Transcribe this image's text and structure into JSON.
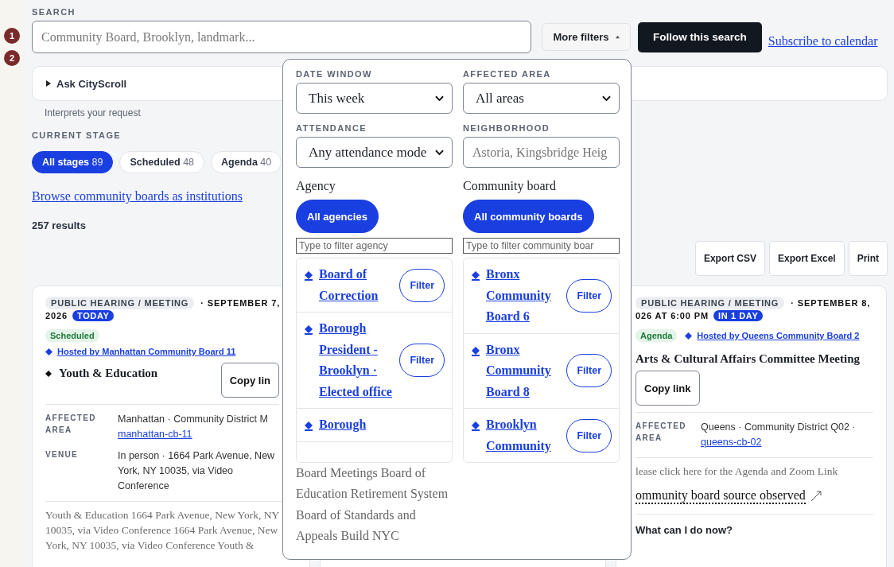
{
  "annotations": [
    "1",
    "2"
  ],
  "search": {
    "label": "SEARCH",
    "placeholder": "Community Board, Brooklyn, landmark..."
  },
  "more_filters": {
    "label": "More filters",
    "expanded": true
  },
  "follow_button": "Follow this search",
  "subscribe_link": "Subscribe to calendar",
  "ask": {
    "label": "Ask CityScroll",
    "expanded": false,
    "hint": "Interprets your request"
  },
  "stage": {
    "label": "CURRENT STAGE",
    "chips": [
      {
        "label": "All stages",
        "count": "89",
        "selected": true
      },
      {
        "label": "Scheduled",
        "count": "48",
        "selected": false
      },
      {
        "label": "Agenda",
        "count": "40",
        "selected": false
      }
    ]
  },
  "browse_link": "Browse community boards as institutions",
  "results": "257 results",
  "export_buttons": [
    "Export CSV",
    "Export Excel",
    "Print"
  ],
  "cards": [
    {
      "type": "PUBLIC HEARING / MEETING",
      "date": "· SEPTEMBER 7,",
      "date_continued": "2026",
      "relative": "TODAY",
      "stage": "Scheduled",
      "host": "Hosted by Manhattan Community Board 11",
      "bullet": true,
      "title": "Youth & Education",
      "copy_button": "Copy lin",
      "details": [
        {
          "label": "AFFECTED AREA",
          "value": "Manhattan · Community District M",
          "link": "manhattan-cb-11"
        },
        {
          "label": "VENUE",
          "value": "In person · 1664 Park Avenue, New York, NY 10035, via Video Conference"
        }
      ],
      "description": "Youth & Education 1664 Park Avenue, New York, NY 10035, via Video Conference 1664 Park Avenue, New York, NY 10035, via Video Conference Youth &"
    },
    {
      "type": "PUBLIC HEARING / MEETING",
      "date": "· SEPTEMBER 8,",
      "date_continued": "026 AT 6:00 PM",
      "relative": "IN 1 DAY",
      "stage": "Agenda",
      "host": "Hosted by Queens Community Board 2",
      "bullet": false,
      "title": "Arts & Cultural Affairs Committee Meeting",
      "copy_button": "Copy link",
      "details": [
        {
          "label": "AFFECTED AREA",
          "value": "Queens · Community District Q02 ·",
          "link": "queens-cb-02"
        }
      ],
      "description": "lease click here for the Agenda and Zoom Link",
      "source_link": "ommunity board source observed",
      "question": "What can I do now?"
    }
  ],
  "filters": {
    "fields": [
      {
        "label": "DATE WINDOW",
        "kind": "select",
        "value": "This week"
      },
      {
        "label": "AFFECTED AREA",
        "kind": "select",
        "value": "All areas"
      },
      {
        "label": "ATTENDANCE",
        "kind": "select",
        "value": "Any attendance mode"
      },
      {
        "label": "NEIGHBORHOOD",
        "kind": "input",
        "placeholder": "Astoria, Kingsbridge Heig"
      }
    ],
    "groups": [
      {
        "title": "Agency",
        "all_button": "All agencies",
        "all_selected": true,
        "filter_placeholder": "Type to filter agency",
        "items": [
          {
            "name": "Board of Correction",
            "action": "Filter"
          },
          {
            "name": "Borough President - Brooklyn · Elected office",
            "action": "Filter"
          },
          {
            "name": "Borough"
          }
        ]
      },
      {
        "title": "Community board",
        "all_button": "All community boards",
        "all_selected": true,
        "filter_placeholder": "Type to filter community boar",
        "items": [
          {
            "name": "Bronx Community Board 6",
            "action": "Filter"
          },
          {
            "name": "Bronx Community Board 8",
            "action": "Filter"
          },
          {
            "name": "Brooklyn Community",
            "action": "Filter"
          }
        ]
      }
    ],
    "overflow_text": "Board Meetings Board of Education Retirement System Board of Standards and Appeals Build NYC"
  }
}
